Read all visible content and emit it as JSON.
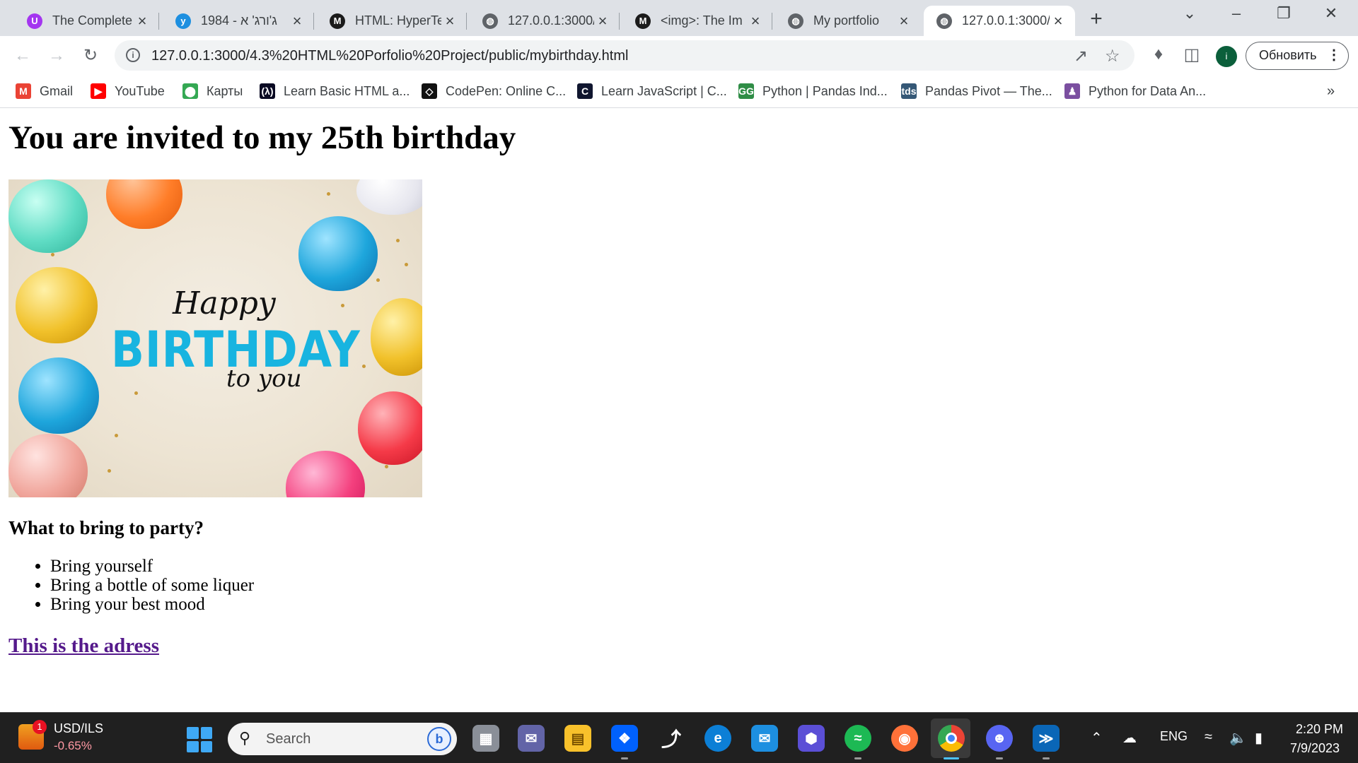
{
  "browser": {
    "tabs": [
      {
        "title": "The Complete",
        "icon": "udemy-icon",
        "color": "#a435f0",
        "glyph": "U"
      },
      {
        "title": "ג'ורג' א - 1984",
        "icon": "book-site-icon",
        "color": "#1d8fe0",
        "glyph": "y"
      },
      {
        "title": "HTML: HyperTe",
        "icon": "mdn-icon",
        "color": "#1b1b1b",
        "glyph": "M"
      },
      {
        "title": "127.0.0.1:3000/",
        "icon": "globe-icon",
        "color": "#5f6368",
        "glyph": "◍"
      },
      {
        "title": "<img>: The Im",
        "icon": "mdn-icon",
        "color": "#1b1b1b",
        "glyph": "M"
      },
      {
        "title": "My portfolio",
        "icon": "globe-icon",
        "color": "#5f6368",
        "glyph": "◍"
      },
      {
        "title": "127.0.0.1:3000/",
        "icon": "globe-icon",
        "color": "#5f6368",
        "glyph": "◍",
        "active": true
      }
    ],
    "new_tab": "+",
    "url": "127.0.0.1:3000/4.3%20HTML%20Porfolio%20Project/public/mybirthday.html",
    "update_label": "Обновить",
    "profile_initial": "i",
    "bookmarks": [
      {
        "label": "Gmail",
        "icon": "gmail-icon",
        "color": "#ea4335",
        "glyph": "M"
      },
      {
        "label": "YouTube",
        "icon": "youtube-icon",
        "color": "#ff0000",
        "glyph": "▶"
      },
      {
        "label": "Карты",
        "icon": "maps-icon",
        "color": "#34a853",
        "glyph": "⬤"
      },
      {
        "label": "Learn Basic HTML a...",
        "icon": "freecodecamp-icon",
        "color": "#0a0a23",
        "glyph": "(λ)"
      },
      {
        "label": "CodePen: Online C...",
        "icon": "codepen-icon",
        "color": "#111111",
        "glyph": "◇"
      },
      {
        "label": "Learn JavaScript | C...",
        "icon": "codecademy-icon",
        "color": "#10162f",
        "glyph": "C"
      },
      {
        "label": "Python | Pandas Ind...",
        "icon": "geeksforgeeks-icon",
        "color": "#2f8d46",
        "glyph": "GG"
      },
      {
        "label": "Pandas Pivot — The...",
        "icon": "tds-icon",
        "color": "#355876",
        "glyph": "tds"
      },
      {
        "label": "Python for Data An...",
        "icon": "hyperiondev-icon",
        "color": "#7b4fa0",
        "glyph": "♟"
      }
    ]
  },
  "page": {
    "heading": "You are invited to my 25th birthday",
    "image": {
      "happy": "Happy",
      "birthday": "BIRTHDAY",
      "to_you": "to you"
    },
    "subheading": "What to bring to party?",
    "list": [
      "Bring yourself",
      "Bring a bottle of some liquer",
      "Bring your best mood"
    ],
    "link": "This is the adress"
  },
  "taskbar": {
    "widget_title": "USD/ILS",
    "widget_value": "-0.65%",
    "widget_badge": "1",
    "search_placeholder": "Search",
    "lang": "ENG",
    "time": "2:20 PM",
    "date": "7/9/2023"
  }
}
